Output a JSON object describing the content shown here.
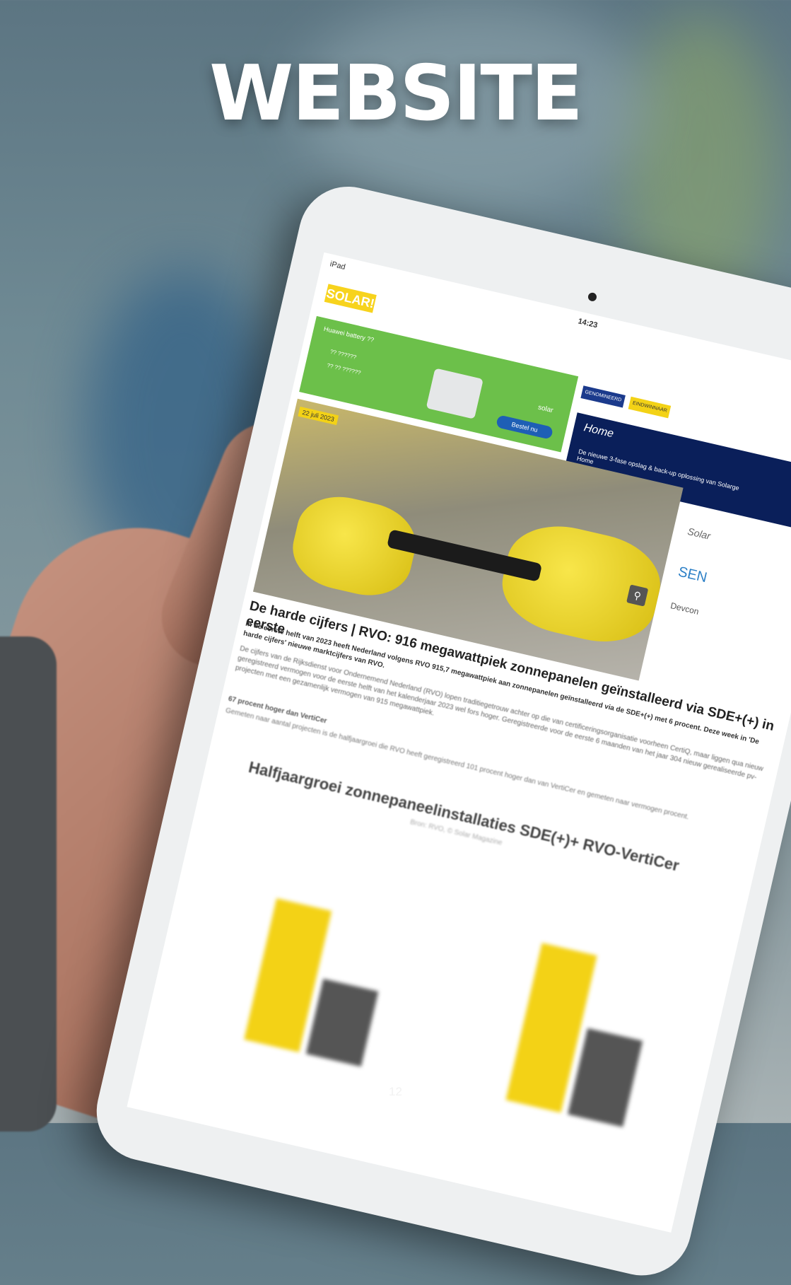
{
  "page": {
    "title": "WEBSITE",
    "page_number": "12"
  },
  "tablet": {
    "status": {
      "device": "iPad",
      "clock": "14:23"
    },
    "logo": "SOLAR!",
    "banner": {
      "title": "Huawei battery ??",
      "points": [
        "?? ??????",
        "?? ?? ??????"
      ],
      "brand": "solar",
      "cta": "Bestel nu"
    },
    "awards": [
      "GENOMINEERD",
      "EINDWINNAAR"
    ],
    "ad": {
      "logo": "Home",
      "text": "De nieuwe 3-fase opslag & back-up oplossing van Solarge Home"
    },
    "hero": {
      "date": "22 juli 2023"
    },
    "sidebar": {
      "title": "Solar",
      "logo1": "SEN",
      "logo2": "Devcon"
    },
    "article": {
      "headline": "De harde cijfers | RVO: 916 megawattpiek zonnepanelen geïnstalleerd via SDE+(+) in eerste",
      "lead": "In de eerste helft van 2023 heeft Nederland volgens RVO 915,7 megawattpiek aan zonnepanelen geïnstalleerd via de SDE+(+) met 6 procent. Deze week in 'De harde cijfers' nieuwe marktcijfers van RVO.",
      "body": "De cijfers van de Rijksdienst voor Ondernemend Nederland (RVO) lopen traditiegetrouw achter op die van certificeringsorganisatie voorheen CertiQ, maar liggen qua nieuw geregistreerd vermogen voor de eerste helft van het kalenderjaar 2023 wel fors hoger. Geregistreerde voor de eerste 6 maanden van het jaar 304 nieuw gerealiseerde pv-projecten met een gezamenlijk vermogen van 915 megawattpiek.",
      "subheading": "67 procent hoger dan VertiCer",
      "body2": "Gemeten naar aantal projecten is de halfjaargroei die RVO heeft geregistreerd 101 procent hoger dan van VertiCer en gemeten naar vermogen procent."
    },
    "chart": {
      "title": "Halfjaargroei zonnepaneelinstallaties SDE(+)+ RVO-VertiCer",
      "source": "Bron: RVO, © Solar Magazine"
    }
  },
  "colors": {
    "accent_yellow": "#f3d216",
    "banner_green": "#6cc04a",
    "ad_navy": "#0a1f5a"
  },
  "chart_data": {
    "type": "bar",
    "title": "Halfjaargroei zonnepaneelinstallaties SDE(+)+ RVO-VertiCer",
    "series": [
      {
        "color": "#f3d216",
        "values": [
          620,
          690
        ]
      },
      {
        "color": "#555555",
        "values": [
          330,
          380
        ]
      }
    ],
    "ylim": [
      0,
      1000
    ]
  }
}
